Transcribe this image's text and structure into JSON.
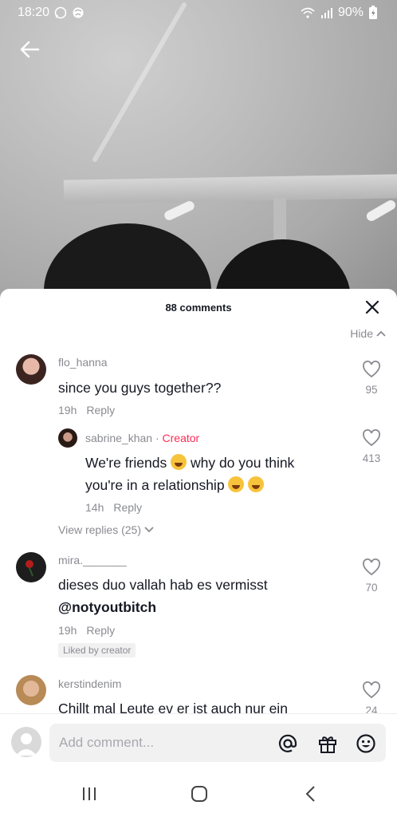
{
  "status": {
    "time": "18:20",
    "battery": "90%"
  },
  "sheet": {
    "title": "88 comments",
    "hide_label": "Hide"
  },
  "comments": [
    {
      "user": "flo_hanna",
      "text": "since you guys together??",
      "time": "19h",
      "reply_label": "Reply",
      "likes": "95"
    },
    {
      "user": "sabrine_khan",
      "creator_tag": "Creator",
      "text_line1_a": "We're friends ",
      "text_line1_b": " why do you think",
      "text_line2": "you're in a relationship ",
      "time": "14h",
      "reply_label": "Reply",
      "likes": "413"
    },
    {
      "view_replies": "View replies (25)"
    },
    {
      "user": "mira._______",
      "text_line1": "dieses duo vallah hab es vermisst",
      "text_line2": "@notyoutbitch",
      "time": "19h",
      "reply_label": "Reply",
      "badge": "Liked by creator",
      "likes": "70"
    },
    {
      "user": "kerstindenim",
      "text": "Chillt mal Leute ev er ist auch nur ein",
      "likes": "24"
    }
  ],
  "composer": {
    "placeholder": "Add comment..."
  },
  "colors": {
    "creator": "#fe2c55",
    "muted": "#8a8b91",
    "text": "#161823"
  }
}
